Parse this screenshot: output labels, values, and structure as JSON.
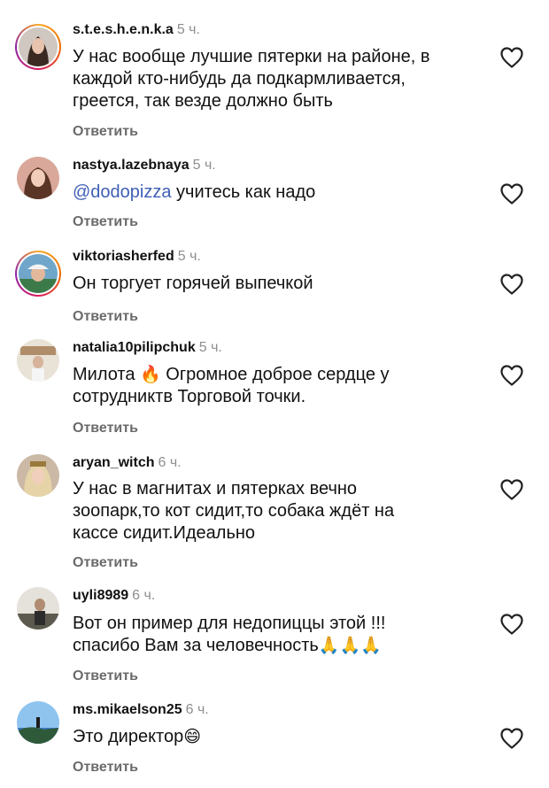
{
  "reply_label": "Ответить",
  "colors": {
    "mention": "#3f5fb5",
    "time": "#8e8e8e",
    "reply": "#6b6b6b"
  },
  "comments": [
    {
      "username": "s.t.e.s.h.e.n.k.a",
      "time": "5 ч.",
      "text": "У нас вообще лучшие пятерки на районе, в\nкаждой кто-нибудь да подкармливается,\nгреется, так везде должно быть",
      "story_ring": true
    },
    {
      "username": "nastya.lazebnaya",
      "time": "5 ч.",
      "mention": "@dodopizza",
      "text": " учитесь как надо",
      "story_ring": false
    },
    {
      "username": "viktoriasherfed",
      "time": "5 ч.",
      "text": "Он торгует горячей выпечкой",
      "story_ring": true
    },
    {
      "username": "natalia10pilipchuk",
      "time": "5 ч.",
      "text_before": "Милота ",
      "emoji": "🔥",
      "text": " Огромное доброе сердце у\nсотрудниктв Торговой точки.",
      "story_ring": false
    },
    {
      "username": "aryan_witch",
      "time": "6 ч.",
      "text": "У нас в магнитах и пятерках вечно\nзоопарк,то кот сидит,то собака ждёт на\nкассе сидит.Идеально",
      "story_ring": false
    },
    {
      "username": "uyli8989",
      "time": "6 ч.",
      "text": "Вот он пример для недопиццы этой !!!\nспасибо Вам за человечность",
      "emoji": "🙏🙏🙏",
      "story_ring": false
    },
    {
      "username": "ms.mikaelson25",
      "time": "6 ч.",
      "text": "Это директор",
      "emoji": "😄",
      "story_ring": false
    }
  ]
}
